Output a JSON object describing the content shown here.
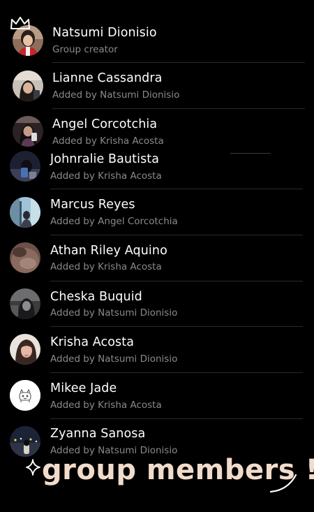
{
  "members": [
    {
      "name": "Natsumi Dionisio",
      "subtitle": "Group creator",
      "avatar": "natsumi-avatar"
    },
    {
      "name": "Lianne Cassandra",
      "subtitle": "Added by Natsumi Dionisio",
      "avatar": "lianne-avatar"
    },
    {
      "name": "Angel Corcotchia",
      "subtitle": "Added by Krisha Acosta",
      "avatar": "angel-avatar"
    },
    {
      "name": "Johnralie Bautista",
      "subtitle": "Added by Krisha Acosta",
      "avatar": "johnralie-avatar"
    },
    {
      "name": "Marcus Reyes",
      "subtitle": "Added by Angel Corcotchia",
      "avatar": "marcus-avatar"
    },
    {
      "name": "Athan Riley Aquino",
      "subtitle": "Added by Krisha Acosta",
      "avatar": "athan-avatar"
    },
    {
      "name": "Cheska Buquid",
      "subtitle": "Added by Natsumi Dionisio",
      "avatar": "cheska-avatar"
    },
    {
      "name": "Krisha Acosta",
      "subtitle": "Added by Natsumi Dionisio",
      "avatar": "krisha-avatar"
    },
    {
      "name": "Mikee Jade",
      "subtitle": "Added by Krisha Acosta",
      "avatar": "mikee-avatar"
    },
    {
      "name": "Zyanna Sanosa",
      "subtitle": "Added by Natsumi Dionisio",
      "avatar": "zyanna-avatar"
    }
  ],
  "caption": "group members !",
  "decorations": {
    "crown": "crown-icon",
    "sparkle": "sparkle-icon",
    "swoosh": "swoosh-icon"
  },
  "colors": {
    "background": "#000000",
    "name_text": "#ffffff",
    "subtitle_text": "#8a8a8e",
    "caption_text": "#f1dccb"
  }
}
